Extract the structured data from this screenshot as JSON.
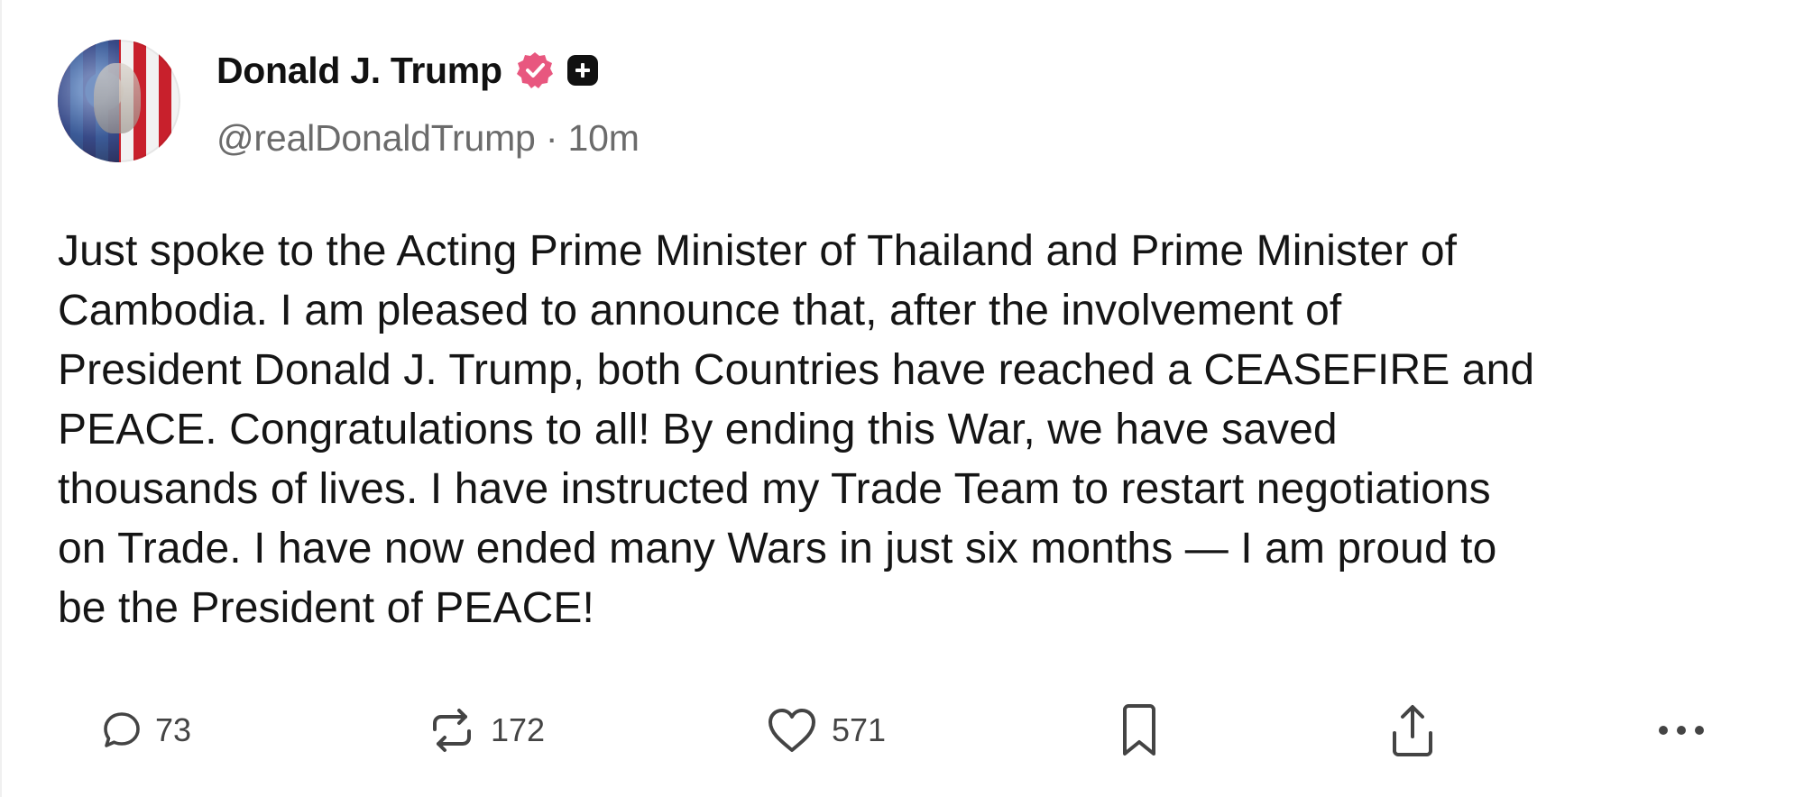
{
  "author": {
    "name": "Donald J. Trump",
    "handle": "@realDonaldTrump",
    "separator": "·",
    "time": "10m"
  },
  "post": {
    "lines": [
      "Just spoke to the Acting Prime Minister of Thailand and Prime Minister of",
      "Cambodia. I am pleased to announce that, after the involvement of",
      "President Donald J. Trump, both Countries have reached a CEASEFIRE and",
      "PEACE. Congratulations to all! By ending this War, we have saved",
      "thousands of lives. I have instructed my Trade Team to restart negotiations",
      "on Trade. I have now ended many Wars in just six months — I am proud to",
      "be the President of PEACE!"
    ]
  },
  "actions": {
    "replies": "73",
    "reposts": "172",
    "likes": "571"
  },
  "icons": {
    "verified": "verified-badge-icon",
    "plus": "plus-badge-icon",
    "reply": "comment-icon",
    "repost": "repost-icon",
    "like": "heart-icon",
    "bookmark": "bookmark-icon",
    "share": "share-icon",
    "more": "more-icon"
  },
  "colors": {
    "verified_badge": "#e8577f",
    "text": "#151515",
    "muted": "#6b6b6b",
    "icon": "#444444"
  }
}
